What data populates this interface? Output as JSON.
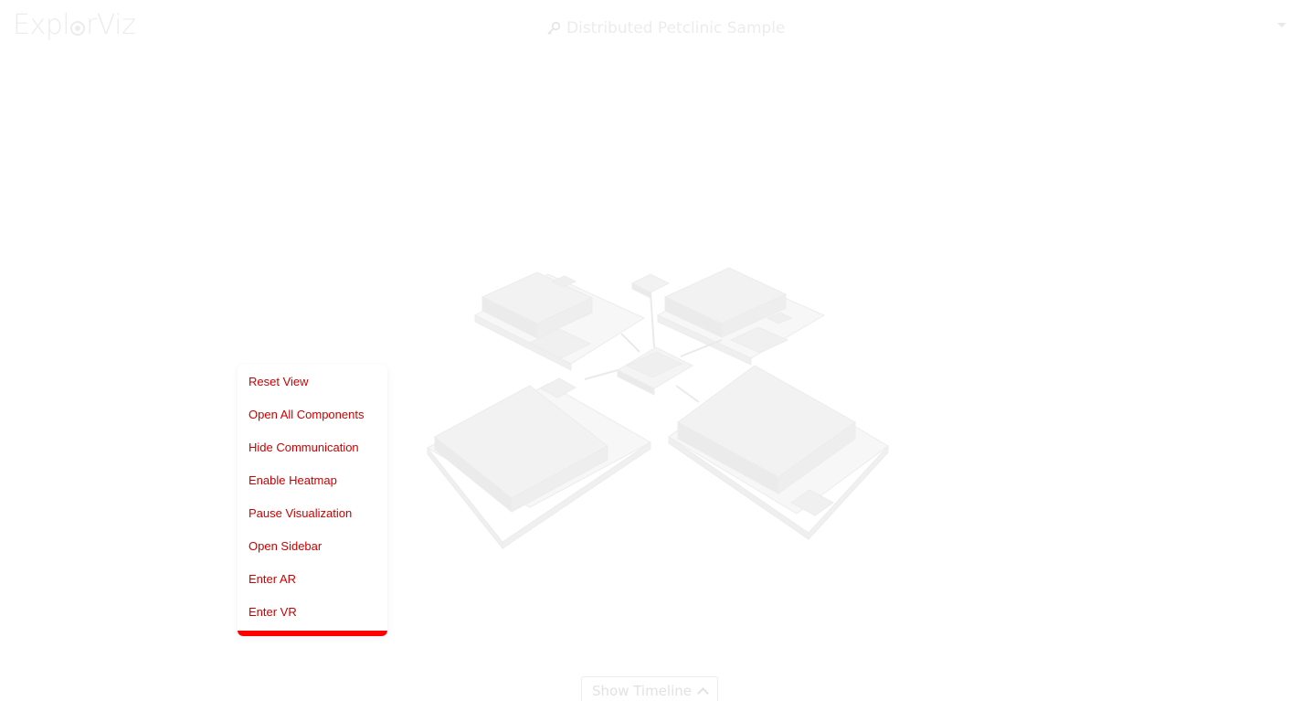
{
  "header": {
    "logo": {
      "text_before": "Expl",
      "text_after": "rViz",
      "eye_icon": "eye-icon"
    },
    "landscape_title": "Distributed Petclinic Sample",
    "landscape_icon": "key-icon",
    "dropdown_icon": "caret-down-icon"
  },
  "context_menu": {
    "items": [
      {
        "label": "Reset View"
      },
      {
        "label": "Open All Components"
      },
      {
        "label": "Hide Communication"
      },
      {
        "label": "Enable Heatmap"
      },
      {
        "label": "Pause Visualization"
      },
      {
        "label": "Open Sidebar"
      },
      {
        "label": "Enter AR"
      },
      {
        "label": "Enter VR"
      }
    ],
    "accent_color": "#ff0000",
    "text_color": "#cc0000"
  },
  "timeline": {
    "label": "Show Timeline",
    "icon": "chevron-up-icon"
  },
  "colors": {
    "background": "#ffffff",
    "faded_ui": "#ececec"
  }
}
